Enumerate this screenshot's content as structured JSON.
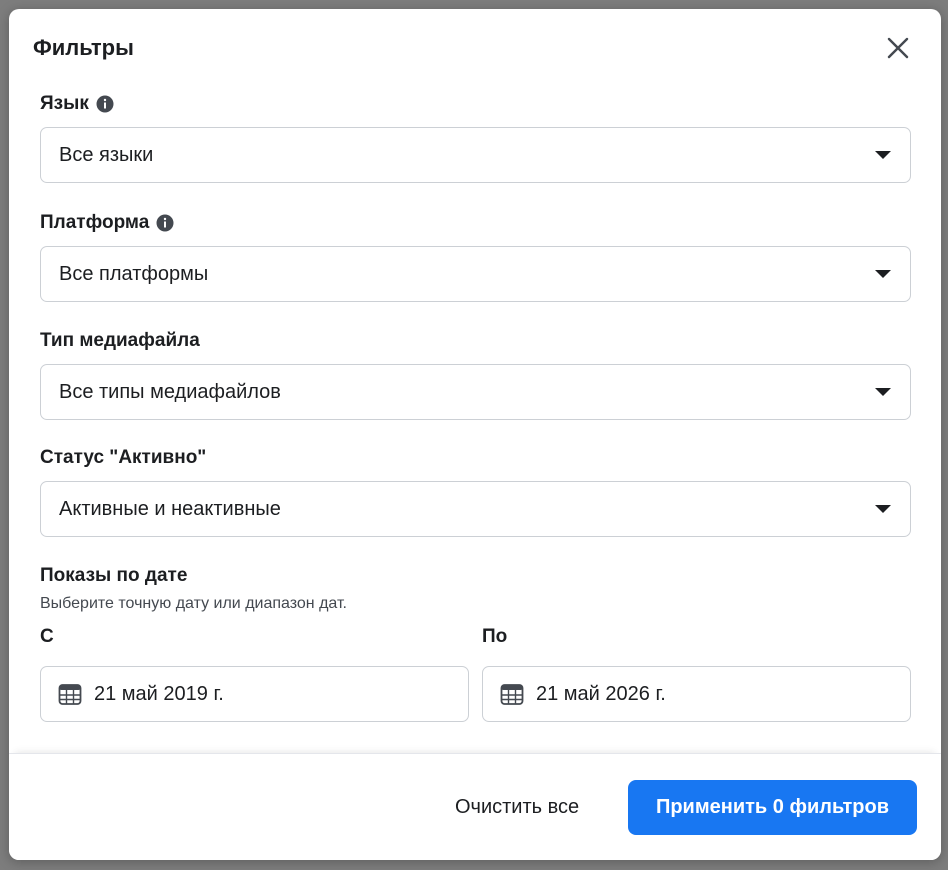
{
  "modal": {
    "title": "Фильтры",
    "close_icon": "close-icon"
  },
  "filters": {
    "language": {
      "label": "Язык",
      "selected": "Все языки",
      "has_info": true
    },
    "platform": {
      "label": "Платформа",
      "selected": "Все платформы",
      "has_info": true
    },
    "media_type": {
      "label": "Тип медиафайла",
      "selected": "Все типы медиафайлов"
    },
    "active_status": {
      "label": "Статус \"Активно\"",
      "selected": "Активные и неактивные"
    },
    "date": {
      "label": "Показы по дате",
      "hint": "Выберите точную дату или диапазон дат.",
      "from_label": "С",
      "from_value": "21 май 2019 г.",
      "to_label": "По",
      "to_value": "21 май 2026 г."
    }
  },
  "footer": {
    "clear_label": "Очистить все",
    "apply_label": "Применить 0 фильтров"
  },
  "colors": {
    "accent": "#1877f2",
    "text": "#1c1e21",
    "border": "#ccd0d5"
  }
}
